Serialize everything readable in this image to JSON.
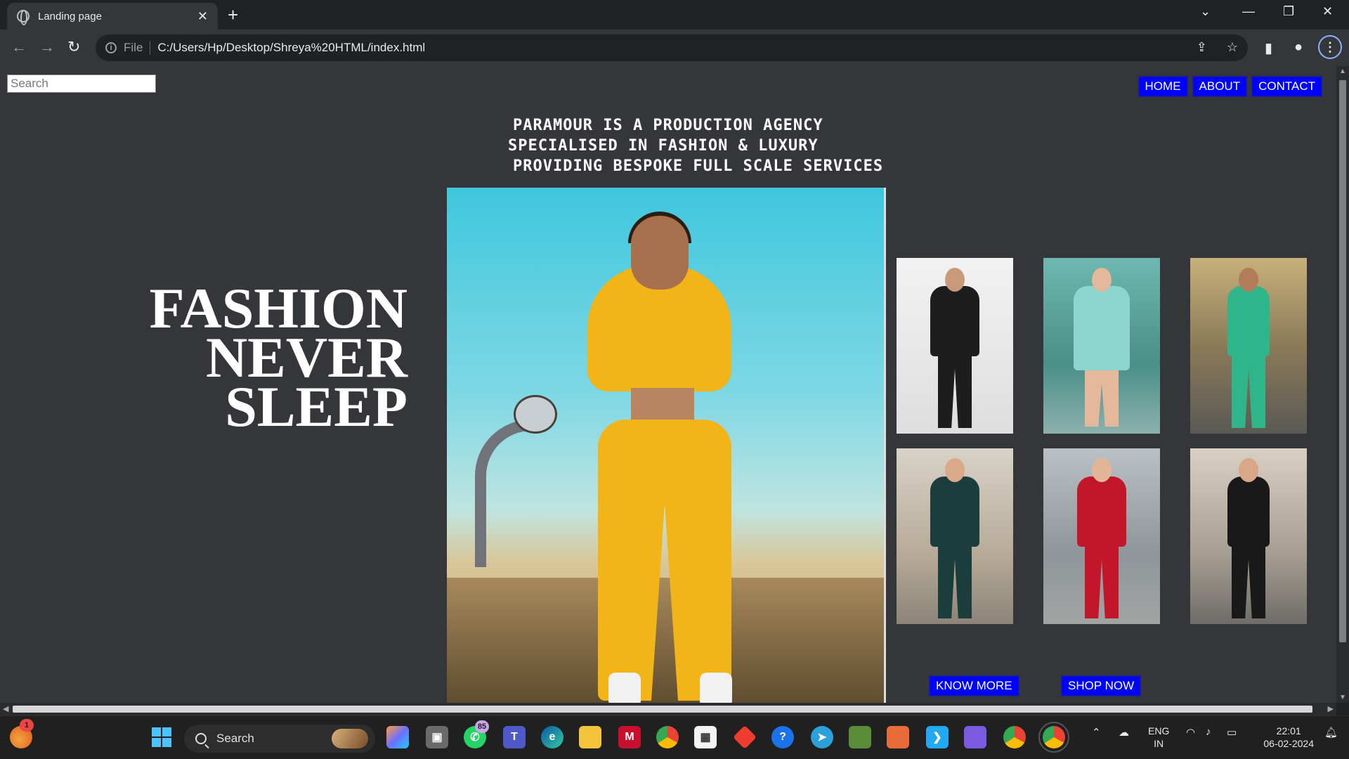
{
  "browser": {
    "tab_title": "Landing page",
    "tab_close": "✕",
    "new_tab": "+",
    "url_prefix": "File",
    "url": "C:/Users/Hp/Desktop/Shreya%20HTML/index.html"
  },
  "page": {
    "search_placeholder": "Search",
    "nav": [
      "HOME",
      "ABOUT",
      "CONTACT"
    ],
    "tagline": [
      "PARAMOUR IS A PRODUCTION AGENCY",
      "SPECIALISED IN FASHION & LUXURY",
      "PROVIDING BESPOKE FULL SCALE SERVICES"
    ],
    "hero_text": [
      "FASHION",
      "NEVER",
      "SLEEP"
    ],
    "cta": {
      "know_more": "KNOW MORE",
      "shop_now": "SHOP NOW"
    },
    "colors": {
      "page_bg": "#35363a",
      "button_bg": "#0000ff",
      "text": "#ffffff"
    }
  },
  "taskbar": {
    "search_label": "Search",
    "whatsapp_badge": "85",
    "weather_badge": "1",
    "lang_top": "ENG",
    "lang_bottom": "IN",
    "time": "22:01",
    "date": "06-02-2024"
  }
}
